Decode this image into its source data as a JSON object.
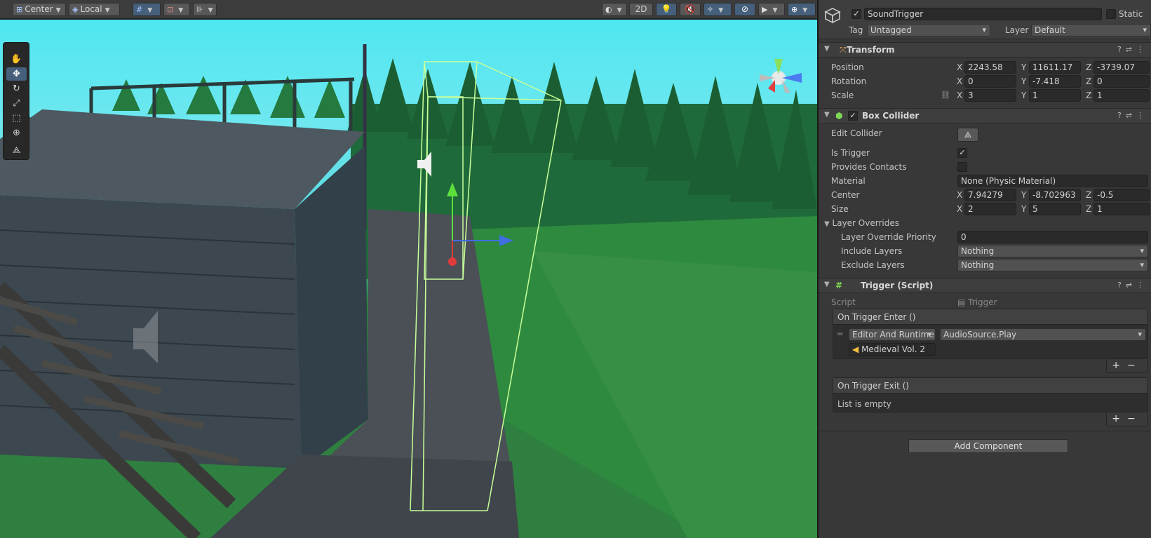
{
  "toolbar": {
    "pivot_mode": "Center",
    "pivot_rotation": "Local",
    "view_2d": "2D"
  },
  "scene_tools": [
    "hand-tool",
    "move-tool",
    "rotate-tool",
    "scale-tool",
    "rect-tool",
    "transform-tool",
    "custom-tool"
  ],
  "inspector": {
    "object_name": "SoundTrigger",
    "active": true,
    "static_label": "Static",
    "tag_label": "Tag",
    "tag_value": "Untagged",
    "layer_label": "Layer",
    "layer_value": "Default",
    "transform": {
      "title": "Transform",
      "position_label": "Position",
      "rotation_label": "Rotation",
      "scale_label": "Scale",
      "position": {
        "x": "2243.58",
        "y": "11611.17",
        "z": "-3739.07"
      },
      "rotation": {
        "x": "0",
        "y": "-7.418",
        "z": "0"
      },
      "scale": {
        "x": "3",
        "y": "1",
        "z": "1"
      }
    },
    "box_collider": {
      "title": "Box Collider",
      "edit_collider_label": "Edit Collider",
      "is_trigger_label": "Is Trigger",
      "is_trigger": true,
      "provides_contacts_label": "Provides Contacts",
      "provides_contacts": false,
      "material_label": "Material",
      "material_value": "None (Physic Material)",
      "center_label": "Center",
      "center": {
        "x": "7.94279",
        "y": "-8.702963",
        "z": "-0.5"
      },
      "size_label": "Size",
      "size": {
        "x": "2",
        "y": "5",
        "z": "1"
      },
      "layer_overrides_label": "Layer Overrides",
      "priority_label": "Layer Override Priority",
      "priority_value": "0",
      "include_label": "Include Layers",
      "include_value": "Nothing",
      "exclude_label": "Exclude Layers",
      "exclude_value": "Nothing"
    },
    "trigger_script": {
      "title": "Trigger (Script)",
      "script_label": "Script",
      "script_value": "Trigger",
      "on_enter_title": "On Trigger Enter ()",
      "runtime_mode": "Editor And Runtime",
      "function": "AudioSource.Play",
      "target": "Medieval Vol. 2",
      "on_exit_title": "On Trigger Exit ()",
      "empty_text": "List is empty"
    },
    "add_component": "Add Component"
  },
  "axis": {
    "x": "X",
    "y": "Y",
    "z": "Z"
  }
}
